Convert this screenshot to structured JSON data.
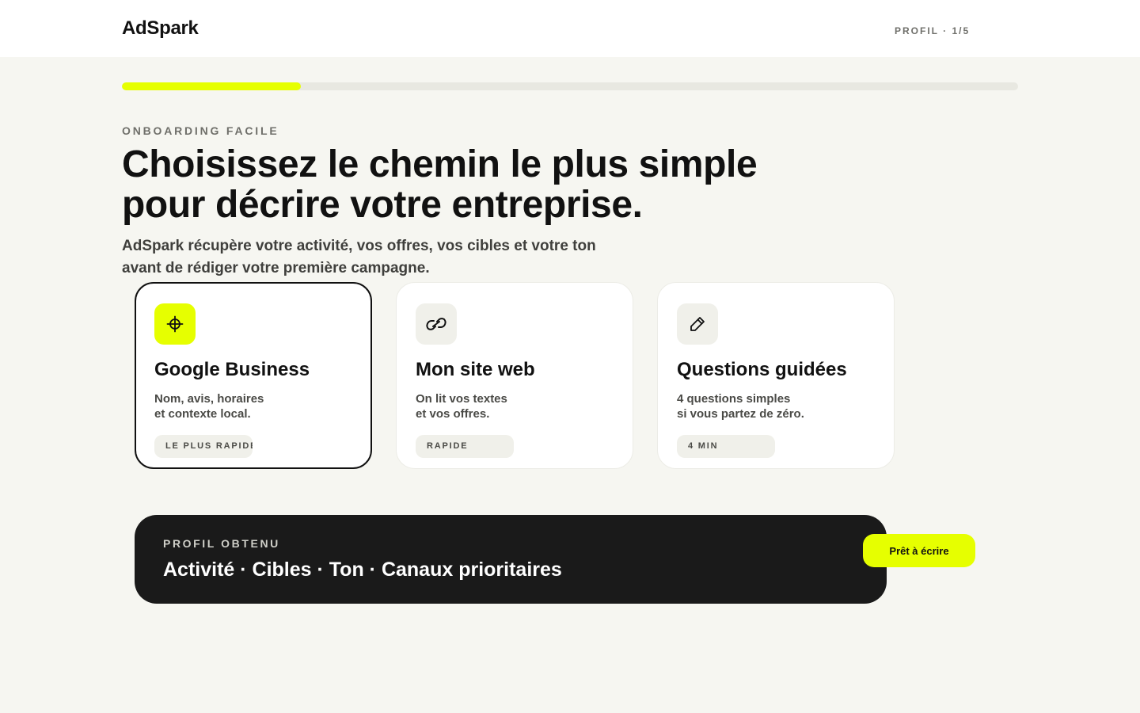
{
  "header": {
    "logo": "AdSpark",
    "step": "PROFIL · 1/5"
  },
  "progress": {
    "fraction": 0.2
  },
  "hero": {
    "eyebrow": "ONBOARDING FACILE",
    "title_line1": "Choisissez le chemin le plus simple",
    "title_line2": "pour décrire votre entreprise.",
    "subtitle_line1": "AdSpark récupère votre activité, vos offres, vos cibles et votre ton",
    "subtitle_line2": "avant de rédiger votre première campagne."
  },
  "options": [
    {
      "icon": "crosshair-icon",
      "title": "Google Business",
      "description": "Nom, avis, horaires\net contexte local.",
      "tag": "LE PLUS RAPIDE",
      "selected": true
    },
    {
      "icon": "link-icon",
      "title": "Mon site web",
      "description": "On lit vos textes\net vos offres.",
      "tag": "RAPIDE",
      "selected": false
    },
    {
      "icon": "pencil-icon",
      "title": "Questions guidées",
      "description": "4 questions simples\nsi vous partez de zéro.",
      "tag": "4 MIN",
      "selected": false
    }
  ],
  "summary": {
    "label": "PROFIL OBTENU",
    "items": "Activité · Cibles · Ton · Canaux prioritaires"
  },
  "cta": {
    "label": "Prêt à écrire"
  },
  "colors": {
    "accent": "#e6ff00",
    "background": "#f6f6f1",
    "dark": "#1a1a1a"
  }
}
